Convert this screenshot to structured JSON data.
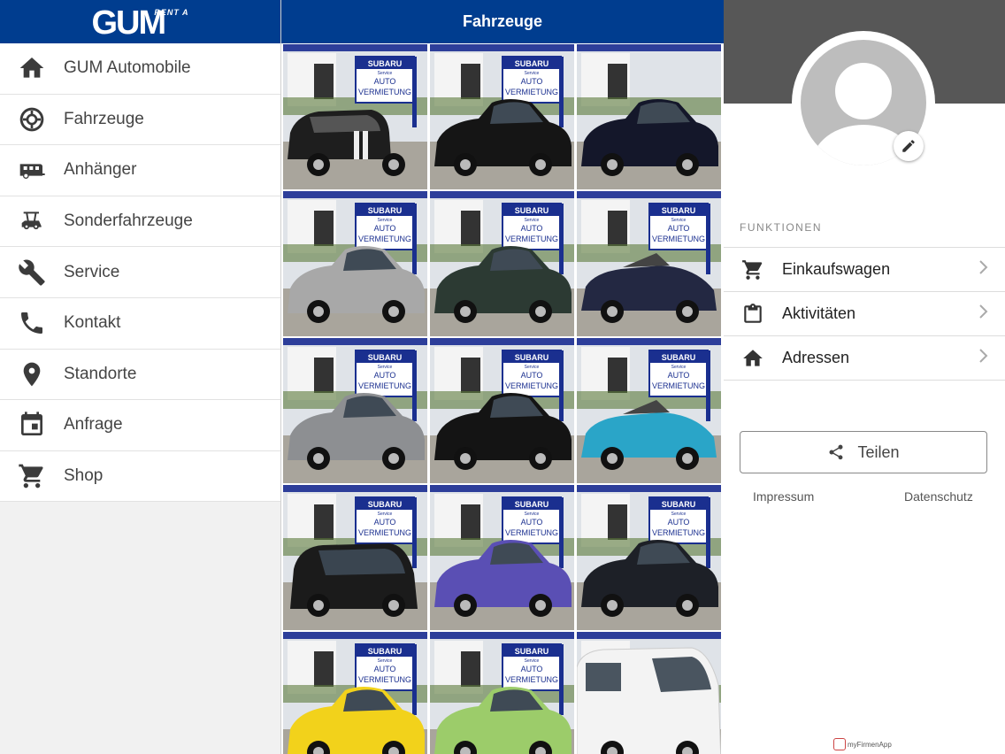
{
  "left": {
    "logo": {
      "main": "GUM",
      "sub": "RENT A"
    },
    "items": [
      {
        "label": "GUM Automobile",
        "icon": "home-icon"
      },
      {
        "label": "Fahrzeuge",
        "icon": "wheel-icon"
      },
      {
        "label": "Anhänger",
        "icon": "trailer-icon"
      },
      {
        "label": "Sonderfahrzeuge",
        "icon": "golf-cart-icon"
      },
      {
        "label": "Service",
        "icon": "wrench-icon"
      },
      {
        "label": "Kontakt",
        "icon": "phone-icon"
      },
      {
        "label": "Standorte",
        "icon": "location-pin-icon"
      },
      {
        "label": "Anfrage",
        "icon": "calendar-icon"
      },
      {
        "label": "Shop",
        "icon": "cart-icon"
      }
    ]
  },
  "middle": {
    "title": "Fahrzeuge",
    "sign": {
      "brand": "SUBARU",
      "sub": "Service",
      "line1": "AUTO",
      "line2": "VERMIETUNG"
    },
    "tiles": [
      {
        "color": "#1e1e1e",
        "kind": "mini",
        "sign": true
      },
      {
        "color": "#151515",
        "kind": "sedan",
        "sign": true
      },
      {
        "color": "#14172a",
        "kind": "sedan",
        "sign": false
      },
      {
        "color": "#a8a8a8",
        "kind": "sedan",
        "sign": true
      },
      {
        "color": "#2c3a33",
        "kind": "sedan",
        "sign": true
      },
      {
        "color": "#232842",
        "kind": "convertible",
        "sign": true
      },
      {
        "color": "#8d8f92",
        "kind": "small",
        "sign": true
      },
      {
        "color": "#141414",
        "kind": "sedan",
        "sign": true
      },
      {
        "color": "#2aa5c8",
        "kind": "convertible",
        "sign": true
      },
      {
        "color": "#1b1b1b",
        "kind": "van",
        "sign": true
      },
      {
        "color": "#5a4fb4",
        "kind": "small",
        "sign": true
      },
      {
        "color": "#1d2027",
        "kind": "small",
        "sign": true
      },
      {
        "color": "#f2d21b",
        "kind": "small",
        "sign": true
      },
      {
        "color": "#9ccc6a",
        "kind": "small",
        "sign": true
      },
      {
        "color": "#f3f3f3",
        "kind": "bus",
        "sign": false
      }
    ]
  },
  "right": {
    "section_label": "FUNKTIONEN",
    "items": [
      {
        "label": "Einkaufswagen",
        "icon": "cart-icon"
      },
      {
        "label": "Aktivitäten",
        "icon": "clipboard-icon"
      },
      {
        "label": "Adressen",
        "icon": "home-icon"
      }
    ],
    "share_label": "Teilen",
    "impressum": "Impressum",
    "datenschutz": "Datenschutz",
    "badge_text": "myFirmenApp"
  },
  "colors": {
    "brand_blue": "#003d8f",
    "profile_gray": "#575757"
  }
}
